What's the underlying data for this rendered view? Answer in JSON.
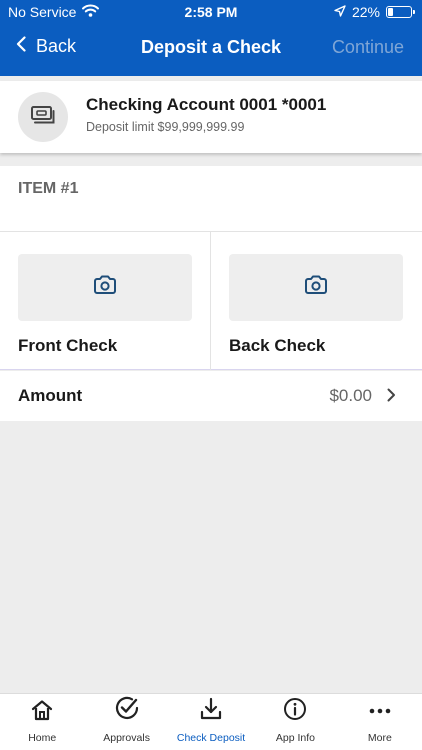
{
  "status_bar": {
    "carrier": "No Service",
    "time": "2:58 PM",
    "battery_percent": "22%",
    "battery_level": 0.22
  },
  "nav": {
    "back_label": "Back",
    "title": "Deposit a Check",
    "continue_label": "Continue"
  },
  "account": {
    "name": "Checking Account 0001 *0001",
    "limit": "Deposit limit $99,999,999.99"
  },
  "item": {
    "label": "ITEM #1"
  },
  "checks": {
    "front_label": "Front Check",
    "back_label": "Back Check"
  },
  "amount": {
    "label": "Amount",
    "value": "$0.00"
  },
  "tabs": [
    {
      "label": "Home",
      "icon": "home-icon"
    },
    {
      "label": "Approvals",
      "icon": "check-circle-icon"
    },
    {
      "label": "Check Deposit",
      "icon": "download-icon"
    },
    {
      "label": "App Info",
      "icon": "info-icon"
    },
    {
      "label": "More",
      "icon": "more-icon"
    }
  ],
  "colors": {
    "brand": "#0b5dc0",
    "continue_disabled": "#7fa6d6",
    "background": "#ededed"
  }
}
